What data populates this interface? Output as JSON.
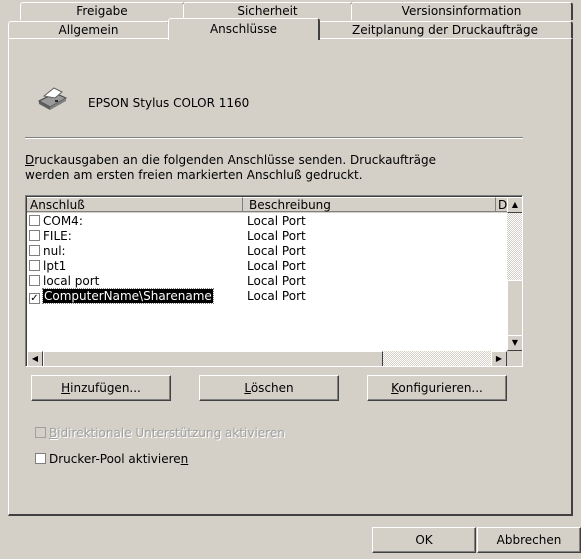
{
  "tabs_back": [
    {
      "label": "Freigabe"
    },
    {
      "label": "Sicherheit"
    },
    {
      "label": "Versionsinformation"
    }
  ],
  "tabs_front": [
    {
      "label": "Allgemein"
    },
    {
      "label": "Anschlüsse"
    },
    {
      "label": "Zeitplanung der Druckaufträge"
    }
  ],
  "printer": {
    "name": "EPSON Stylus COLOR 1160",
    "icon": "printer-icon"
  },
  "description": {
    "line1": "Druckausgaben an die folgenden Anschlüsse senden. Druckaufträge",
    "line2": "werden am ersten freien markierten Anschluß gedruckt."
  },
  "ports_table": {
    "columns": [
      "Anschluß",
      "Beschreibung",
      "D"
    ],
    "rows": [
      {
        "port": "COM4:",
        "desc": "Local Port",
        "checked": false
      },
      {
        "port": "FILE:",
        "desc": "Local Port",
        "checked": false
      },
      {
        "port": "nul:",
        "desc": "Local Port",
        "checked": false
      },
      {
        "port": "lpt1",
        "desc": "Local Port",
        "checked": false
      },
      {
        "port": "local port",
        "desc": "Local Port",
        "checked": false
      },
      {
        "port": "ComputerName\\Sharename",
        "desc": "Local Port",
        "checked": true,
        "selected": true
      }
    ]
  },
  "buttons": {
    "add_pre": "",
    "add_ul": "H",
    "add_post": "inzufügen...",
    "delete_pre": "",
    "delete_ul": "L",
    "delete_post": "öschen",
    "config_pre": "",
    "config_ul": "K",
    "config_post": "onfigurieren..."
  },
  "options": {
    "bidi_pre": "",
    "bidi_ul": "B",
    "bidi_post": "idirektionale Unterstützung aktivieren",
    "bidi_enabled": false,
    "pool_pre": "Drucker-Pool aktiviere",
    "pool_ul": "n",
    "pool_post": "",
    "pool_checked": false
  },
  "footer": {
    "ok": "OK",
    "cancel": "Abbrechen"
  }
}
